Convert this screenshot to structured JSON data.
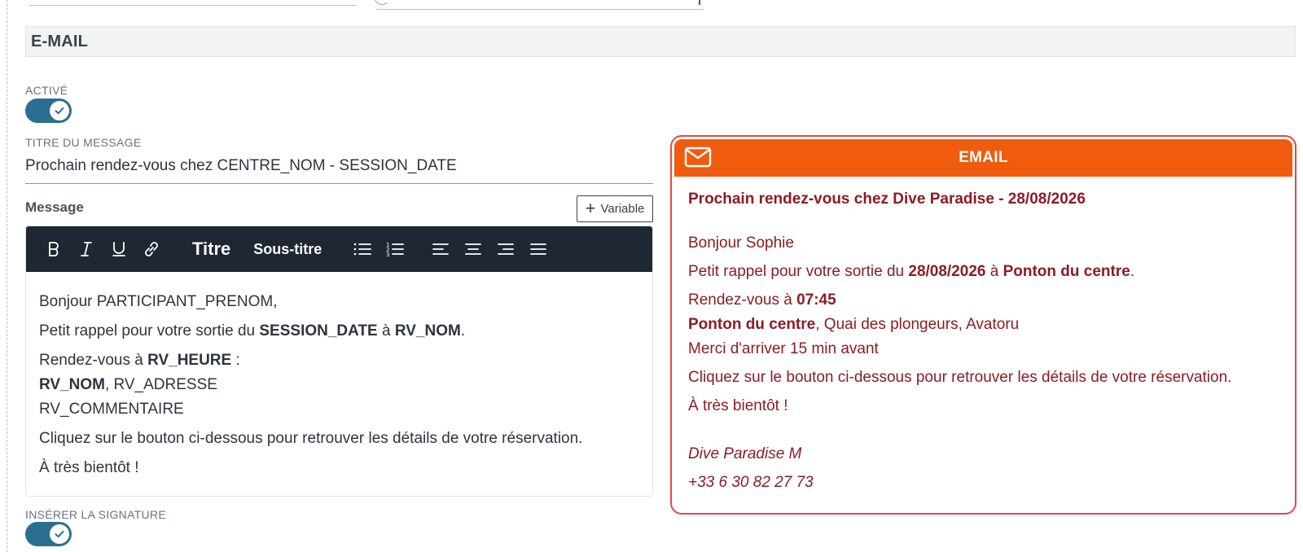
{
  "section": {
    "title": "E-MAIL"
  },
  "active": {
    "label": "ACTIVÉ",
    "on": true
  },
  "title_field": {
    "label": "TITRE DU MESSAGE",
    "value": "Prochain rendez-vous chez CENTRE_NOM - SESSION_DATE"
  },
  "message": {
    "label": "Message",
    "variable_button": "Variable",
    "toolbar": {
      "title": "Titre",
      "subtitle": "Sous-titre"
    },
    "body": {
      "greeting": "Bonjour PARTICIPANT_PRENOM,",
      "reminder_a": "Petit rappel pour votre sortie du ",
      "reminder_date": "SESSION_DATE",
      "reminder_b": " à ",
      "reminder_place": "RV_NOM",
      "reminder_c": ".",
      "meet_a": "Rendez-vous à ",
      "meet_time": "RV_HEURE",
      "meet_b": " :",
      "place_name": "RV_NOM",
      "place_address": ", RV_ADRESSE",
      "comment": "RV_COMMENTAIRE",
      "click": "Cliquez sur le bouton ci-dessous pour retrouver les détails de votre réservation.",
      "bye": "À très bientôt !"
    }
  },
  "signature": {
    "label": "INSÉRER LA SIGNATURE",
    "on": true
  },
  "preview": {
    "header": "EMAIL",
    "subject": "Prochain rendez-vous chez Dive Paradise - 28/08/2026",
    "greeting": "Bonjour Sophie",
    "reminder_a": "Petit rappel pour votre sortie du ",
    "reminder_date": "28/08/2026",
    "reminder_b": " à ",
    "reminder_place": "Ponton du centre",
    "reminder_c": ".",
    "meet_a": "Rendez-vous à ",
    "meet_time": "07:45",
    "place_name": "Ponton du centre",
    "place_address": ", Quai des plongeurs, Avatoru",
    "comment": "Merci d'arriver 15 min avant",
    "click": "Cliquez sur le bouton ci-dessous pour retrouver les détails de votre réservation.",
    "bye": "À très bientôt !",
    "signature_name": "Dive Paradise M",
    "signature_phone": "+33 6 30 82 27 73"
  },
  "colors": {
    "toggle": "#2a6f8f",
    "toolbar": "#1f2733",
    "preview_border": "#e4474a",
    "preview_header": "#f15b0d",
    "preview_text": "#8b1c24"
  },
  "icons": [
    "check-icon",
    "plus-icon",
    "bold-icon",
    "italic-icon",
    "underline-icon",
    "link-icon",
    "bullet-list-icon",
    "ordered-list-icon",
    "align-left-icon",
    "align-center-icon",
    "align-right-icon",
    "align-justify-icon",
    "mail-icon"
  ]
}
